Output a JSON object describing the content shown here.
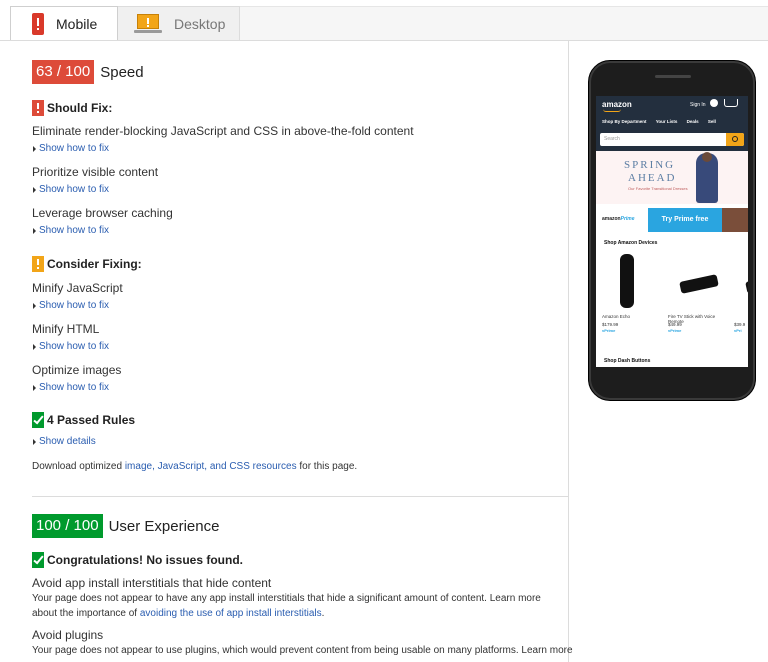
{
  "tabs": [
    {
      "label": "Mobile",
      "icon": "mobile-icon",
      "active": true
    },
    {
      "label": "Desktop",
      "icon": "desktop-icon",
      "active": false
    }
  ],
  "speed": {
    "score": "63 / 100",
    "title": "Speed",
    "should_fix": {
      "heading": "Should Fix:",
      "rules": [
        {
          "title": "Eliminate render-blocking JavaScript and CSS in above-the-fold content",
          "link": "Show how to fix"
        },
        {
          "title": "Prioritize visible content",
          "link": "Show how to fix"
        },
        {
          "title": "Leverage browser caching",
          "link": "Show how to fix"
        }
      ]
    },
    "consider_fixing": {
      "heading": "Consider Fixing:",
      "rules": [
        {
          "title": "Minify JavaScript",
          "link": "Show how to fix"
        },
        {
          "title": "Minify HTML",
          "link": "Show how to fix"
        },
        {
          "title": "Optimize images",
          "link": "Show how to fix"
        }
      ]
    },
    "passed": {
      "heading": "4 Passed Rules",
      "link": "Show details"
    },
    "download": {
      "prefix": "Download optimized ",
      "link": "image, JavaScript, and CSS resources",
      "suffix": " for this page."
    }
  },
  "ux": {
    "score": "100 / 100",
    "title": "User Experience",
    "congrats": "Congratulations! No issues found.",
    "items": [
      {
        "title": "Avoid app install interstitials that hide content",
        "desc_prefix": "Your page does not appear to have any app install interstitials that hide a significant amount of content. Learn more about the importance of ",
        "desc_link": "avoiding the use of app install interstitials",
        "desc_suffix": "."
      },
      {
        "title": "Avoid plugins",
        "desc_prefix": "Your page does not appear to use plugins, which would prevent content from being usable on many platforms. Learn more"
      }
    ]
  },
  "preview": {
    "logo": "amazon",
    "sign_in": "Sign In",
    "nav": [
      "Shop By Department",
      "Your Lists",
      "Deals",
      "Sell"
    ],
    "search_placeholder": "Search",
    "banner_line1": "SPRING",
    "banner_line2": "AHEAD",
    "banner_sub": "Our Favorite Transitional Dresses",
    "prime_logo": "amazon",
    "prime_logo_suffix": "Prime",
    "prime_cta": "Try Prime free",
    "devices_title": "Shop Amazon Devices",
    "devices": [
      {
        "name": "Amazon Echo",
        "price": "$179.99",
        "prime": "vPrime"
      },
      {
        "name": "Fire TV Stick with Voice Remote",
        "price": "$49.99",
        "prime": "vPrime"
      },
      {
        "name": "",
        "price": "$39.9",
        "prime": "vPri"
      }
    ],
    "dash_title": "Shop Dash Buttons"
  },
  "colors": {
    "red": "#dd4b39",
    "orange": "#f2a518",
    "green": "#009a2d",
    "link": "#2a5db0"
  }
}
